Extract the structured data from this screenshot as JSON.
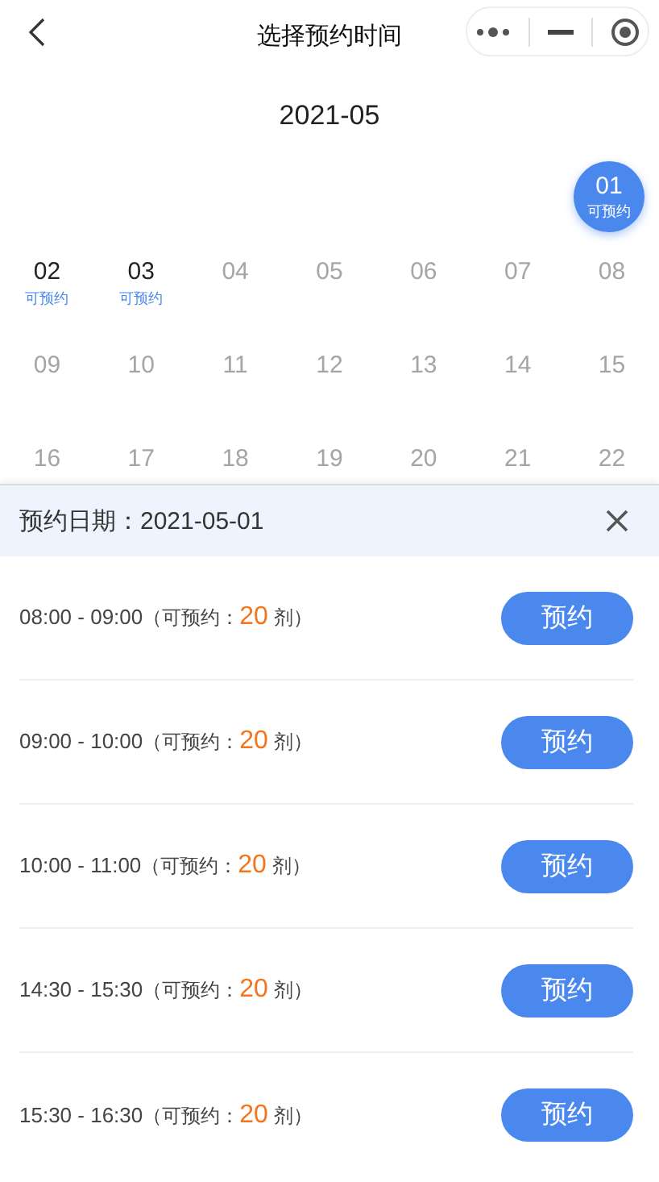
{
  "header": {
    "title": "选择预约时间"
  },
  "calendar": {
    "month": "2021-05",
    "weeks": [
      {
        "days": [
          {
            "day": "01",
            "note": "可预约",
            "available": true,
            "selected": true
          }
        ]
      },
      {
        "days": [
          {
            "day": "02",
            "note": "可预约",
            "available": true,
            "selected": false
          },
          {
            "day": "03",
            "note": "可预约",
            "available": true,
            "selected": false
          },
          {
            "day": "04",
            "available": false,
            "selected": false
          },
          {
            "day": "05",
            "available": false,
            "selected": false
          },
          {
            "day": "06",
            "available": false,
            "selected": false
          },
          {
            "day": "07",
            "available": false,
            "selected": false
          },
          {
            "day": "08",
            "available": false,
            "selected": false
          }
        ]
      },
      {
        "days": [
          {
            "day": "09",
            "available": false,
            "selected": false
          },
          {
            "day": "10",
            "available": false,
            "selected": false
          },
          {
            "day": "11",
            "available": false,
            "selected": false
          },
          {
            "day": "12",
            "available": false,
            "selected": false
          },
          {
            "day": "13",
            "available": false,
            "selected": false
          },
          {
            "day": "14",
            "available": false,
            "selected": false
          },
          {
            "day": "15",
            "available": false,
            "selected": false
          }
        ]
      },
      {
        "days": [
          {
            "day": "16",
            "available": false,
            "selected": false
          },
          {
            "day": "17",
            "available": false,
            "selected": false
          },
          {
            "day": "18",
            "available": false,
            "selected": false
          },
          {
            "day": "19",
            "available": false,
            "selected": false
          },
          {
            "day": "20",
            "available": false,
            "selected": false
          },
          {
            "day": "21",
            "available": false,
            "selected": false
          },
          {
            "day": "22",
            "available": false,
            "selected": false
          }
        ]
      }
    ]
  },
  "panel": {
    "date_label": "预约日期：2021-05-01",
    "slots": [
      {
        "time": "08:00 - 09:00",
        "open": "（可预约：",
        "count": "20",
        "close": " 剂）",
        "button": "预约"
      },
      {
        "time": "09:00 - 10:00",
        "open": "（可预约：",
        "count": "20",
        "close": " 剂）",
        "button": "预约"
      },
      {
        "time": "10:00 - 11:00",
        "open": "（可预约：",
        "count": "20",
        "close": " 剂）",
        "button": "预约"
      },
      {
        "time": "14:30 - 15:30",
        "open": "（可预约：",
        "count": "20",
        "close": " 剂）",
        "button": "预约"
      },
      {
        "time": "15:30 - 16:30",
        "open": "（可预约：",
        "count": "20",
        "close": " 剂）",
        "button": "预约"
      }
    ]
  }
}
